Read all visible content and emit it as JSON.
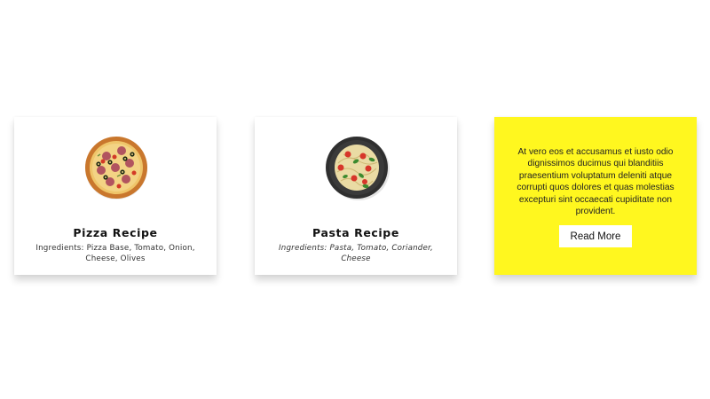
{
  "cards": [
    {
      "title": "Pizza Recipe",
      "ingredients": "Ingredients: Pizza Base, Tomato, Onion, Cheese, Olives",
      "image_icon": "pizza-icon"
    },
    {
      "title": "Pasta Recipe",
      "ingredients": "Ingredients: Pasta, Tomato, Coriander, Cheese",
      "image_icon": "pasta-bowl-icon"
    }
  ],
  "promo": {
    "text": "At vero eos et accusamus et iusto odio dignissimos ducimus qui blanditiis praesentium voluptatum deleniti atque corrupti quos dolores et quas molestias excepturi sint occaecati cupiditate non provident.",
    "button_label": "Read More",
    "background_color": "#fff71f"
  }
}
